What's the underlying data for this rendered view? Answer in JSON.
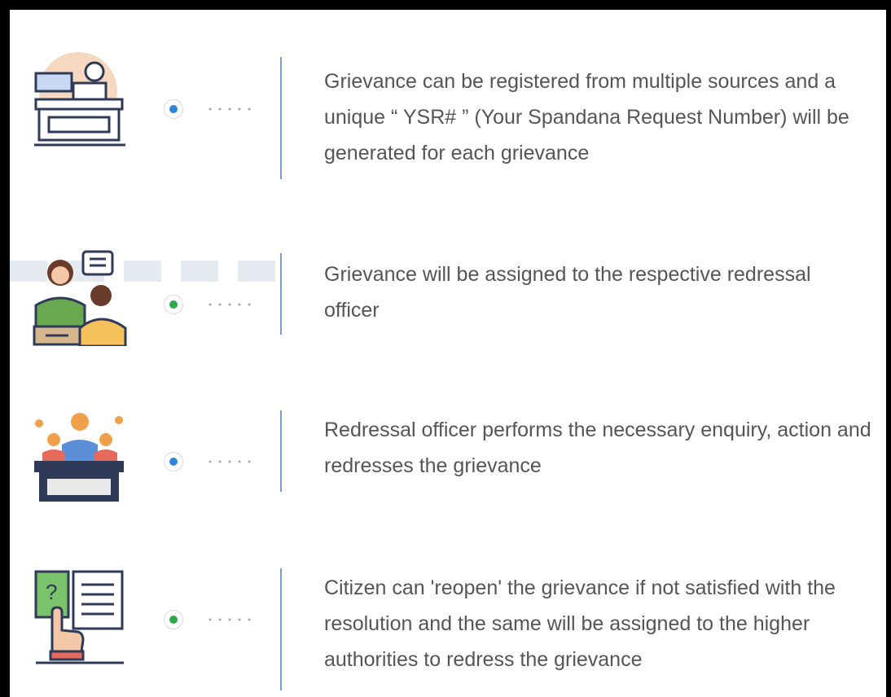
{
  "steps": [
    {
      "text": "Grievance can be registered from multiple sources and a unique “ YSR# ” (Your Spandana Request Number) will be generated for each grievance",
      "icon": "registration-desk-icon",
      "dot_color": "#2f86d6"
    },
    {
      "text": "Grievance will be assigned to the respective redressal officer",
      "icon": "officer-assignment-icon",
      "dot_color": "#2ea84f"
    },
    {
      "text": "Redressal officer performs the necessary enquiry, action and redresses the grievance",
      "icon": "enquiry-meeting-icon",
      "dot_color": "#2f86d6"
    },
    {
      "text": "Citizen can 'reopen' the grievance if not satisfied with the resolution and the same will be assigned to the higher authorities to redress the grievance",
      "icon": "reopen-document-icon",
      "dot_color": "#2ea84f"
    }
  ]
}
